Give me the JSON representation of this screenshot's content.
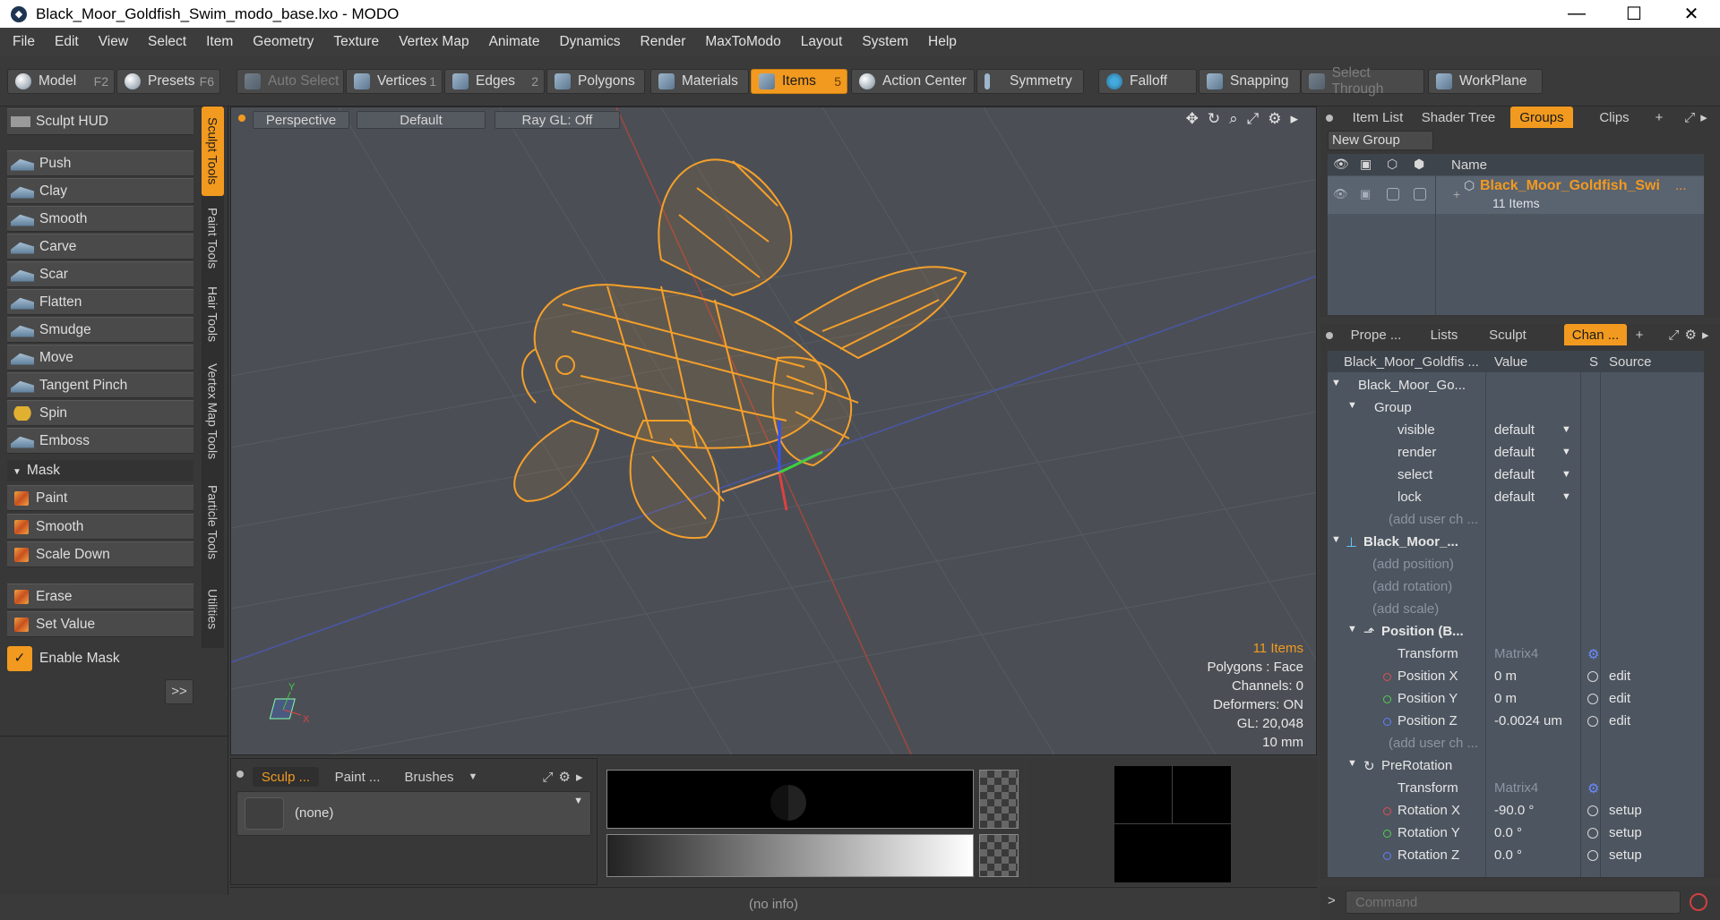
{
  "window": {
    "title": "Black_Moor_Goldfish_Swim_modo_base.lxo - MODO",
    "minimize": "—",
    "maximize": "☐",
    "close": "✕"
  },
  "menu": [
    "File",
    "Edit",
    "View",
    "Select",
    "Item",
    "Geometry",
    "Texture",
    "Vertex Map",
    "Animate",
    "Dynamics",
    "Render",
    "MaxToModo",
    "Layout",
    "System",
    "Help"
  ],
  "toolbar": {
    "model": "Model",
    "model_key": "F2",
    "presets": "Presets",
    "presets_key": "F6",
    "auto_select": "Auto Select",
    "vertices": "Vertices",
    "vertices_key": "1",
    "edges": "Edges",
    "edges_key": "2",
    "polygons": "Polygons",
    "materials": "Materials",
    "items": "Items",
    "items_key": "5",
    "action_center": "Action Center",
    "symmetry": "Symmetry",
    "falloff": "Falloff",
    "snapping": "Snapping",
    "select_through": "Select Through",
    "workplane": "WorkPlane"
  },
  "left_panel": {
    "sculpt_hud": "Sculpt HUD",
    "tools": [
      "Push",
      "Clay",
      "Smooth",
      "Carve",
      "Scar",
      "Flatten",
      "Smudge",
      "Move",
      "Tangent Pinch",
      "Spin",
      "Emboss"
    ],
    "mask_header": "Mask",
    "mask_tools": [
      "Paint",
      "Smooth",
      "Scale Down"
    ],
    "extra_tools": [
      "Erase",
      "Set Value"
    ],
    "enable_mask": "Enable Mask",
    "expand": ">>",
    "side_tabs": [
      "Sculpt Tools",
      "Paint Tools",
      "Hair Tools",
      "Vertex Map Tools",
      "Particle Tools",
      "Utilities"
    ]
  },
  "viewport": {
    "view": "Perspective",
    "shading": "Default",
    "raygl": "Ray GL: Off",
    "info": {
      "items": "11 Items",
      "polygons": "Polygons : Face",
      "channels": "Channels: 0",
      "deformers": "Deformers: ON",
      "gl": "GL: 20,048",
      "scale": "10 mm"
    }
  },
  "bottom_left": {
    "tabs": [
      "Sculp ...",
      "Paint ...",
      "Brushes"
    ],
    "brush": "(none)"
  },
  "status": "(no info)",
  "right_top": {
    "tabs": [
      "Item List",
      "Shader Tree",
      "Groups",
      "Clips"
    ],
    "new_group": "New Group",
    "name_header": "Name",
    "group_name": "Black_Moor_Goldfish_Swi",
    "group_count": "11 Items"
  },
  "right_bottom": {
    "tabs": [
      "Prope ...",
      "Lists",
      "Sculpt",
      "Chan ..."
    ],
    "headers": {
      "name": "Black_Moor_Goldfis ...",
      "value": "Value",
      "s": "S",
      "source": "Source"
    },
    "rows": [
      {
        "name": "Black_Moor_Go...",
        "value": "",
        "source": ""
      },
      {
        "name": "Group",
        "value": "",
        "source": ""
      },
      {
        "name": "visible",
        "value": "default",
        "source": ""
      },
      {
        "name": "render",
        "value": "default",
        "source": ""
      },
      {
        "name": "select",
        "value": "default",
        "source": ""
      },
      {
        "name": "lock",
        "value": "default",
        "source": ""
      },
      {
        "name": "(add user ch ...",
        "value": "",
        "source": ""
      },
      {
        "name": "Black_Moor_...",
        "value": "",
        "source": ""
      },
      {
        "name": "(add position)",
        "value": "",
        "source": ""
      },
      {
        "name": "(add rotation)",
        "value": "",
        "source": ""
      },
      {
        "name": "(add scale)",
        "value": "",
        "source": ""
      },
      {
        "name": "Position (B...",
        "value": "",
        "source": ""
      },
      {
        "name": "Transform",
        "value": "Matrix4",
        "source": ""
      },
      {
        "name": "Position X",
        "value": "0 m",
        "source": "edit"
      },
      {
        "name": "Position Y",
        "value": "0 m",
        "source": "edit"
      },
      {
        "name": "Position Z",
        "value": "-0.0024 um",
        "source": "edit"
      },
      {
        "name": "(add user ch ...",
        "value": "",
        "source": ""
      },
      {
        "name": "PreRotation",
        "value": "",
        "source": ""
      },
      {
        "name": "Transform",
        "value": "Matrix4",
        "source": ""
      },
      {
        "name": "Rotation X",
        "value": "-90.0 °",
        "source": "setup"
      },
      {
        "name": "Rotation Y",
        "value": "0.0 °",
        "source": "setup"
      },
      {
        "name": "Rotation Z",
        "value": "0.0 °",
        "source": "setup"
      }
    ]
  },
  "command": {
    "placeholder": "Command",
    "prompt": ">"
  },
  "colors": {
    "accent": "#f29a1f",
    "mesh": "#f5a02a"
  }
}
